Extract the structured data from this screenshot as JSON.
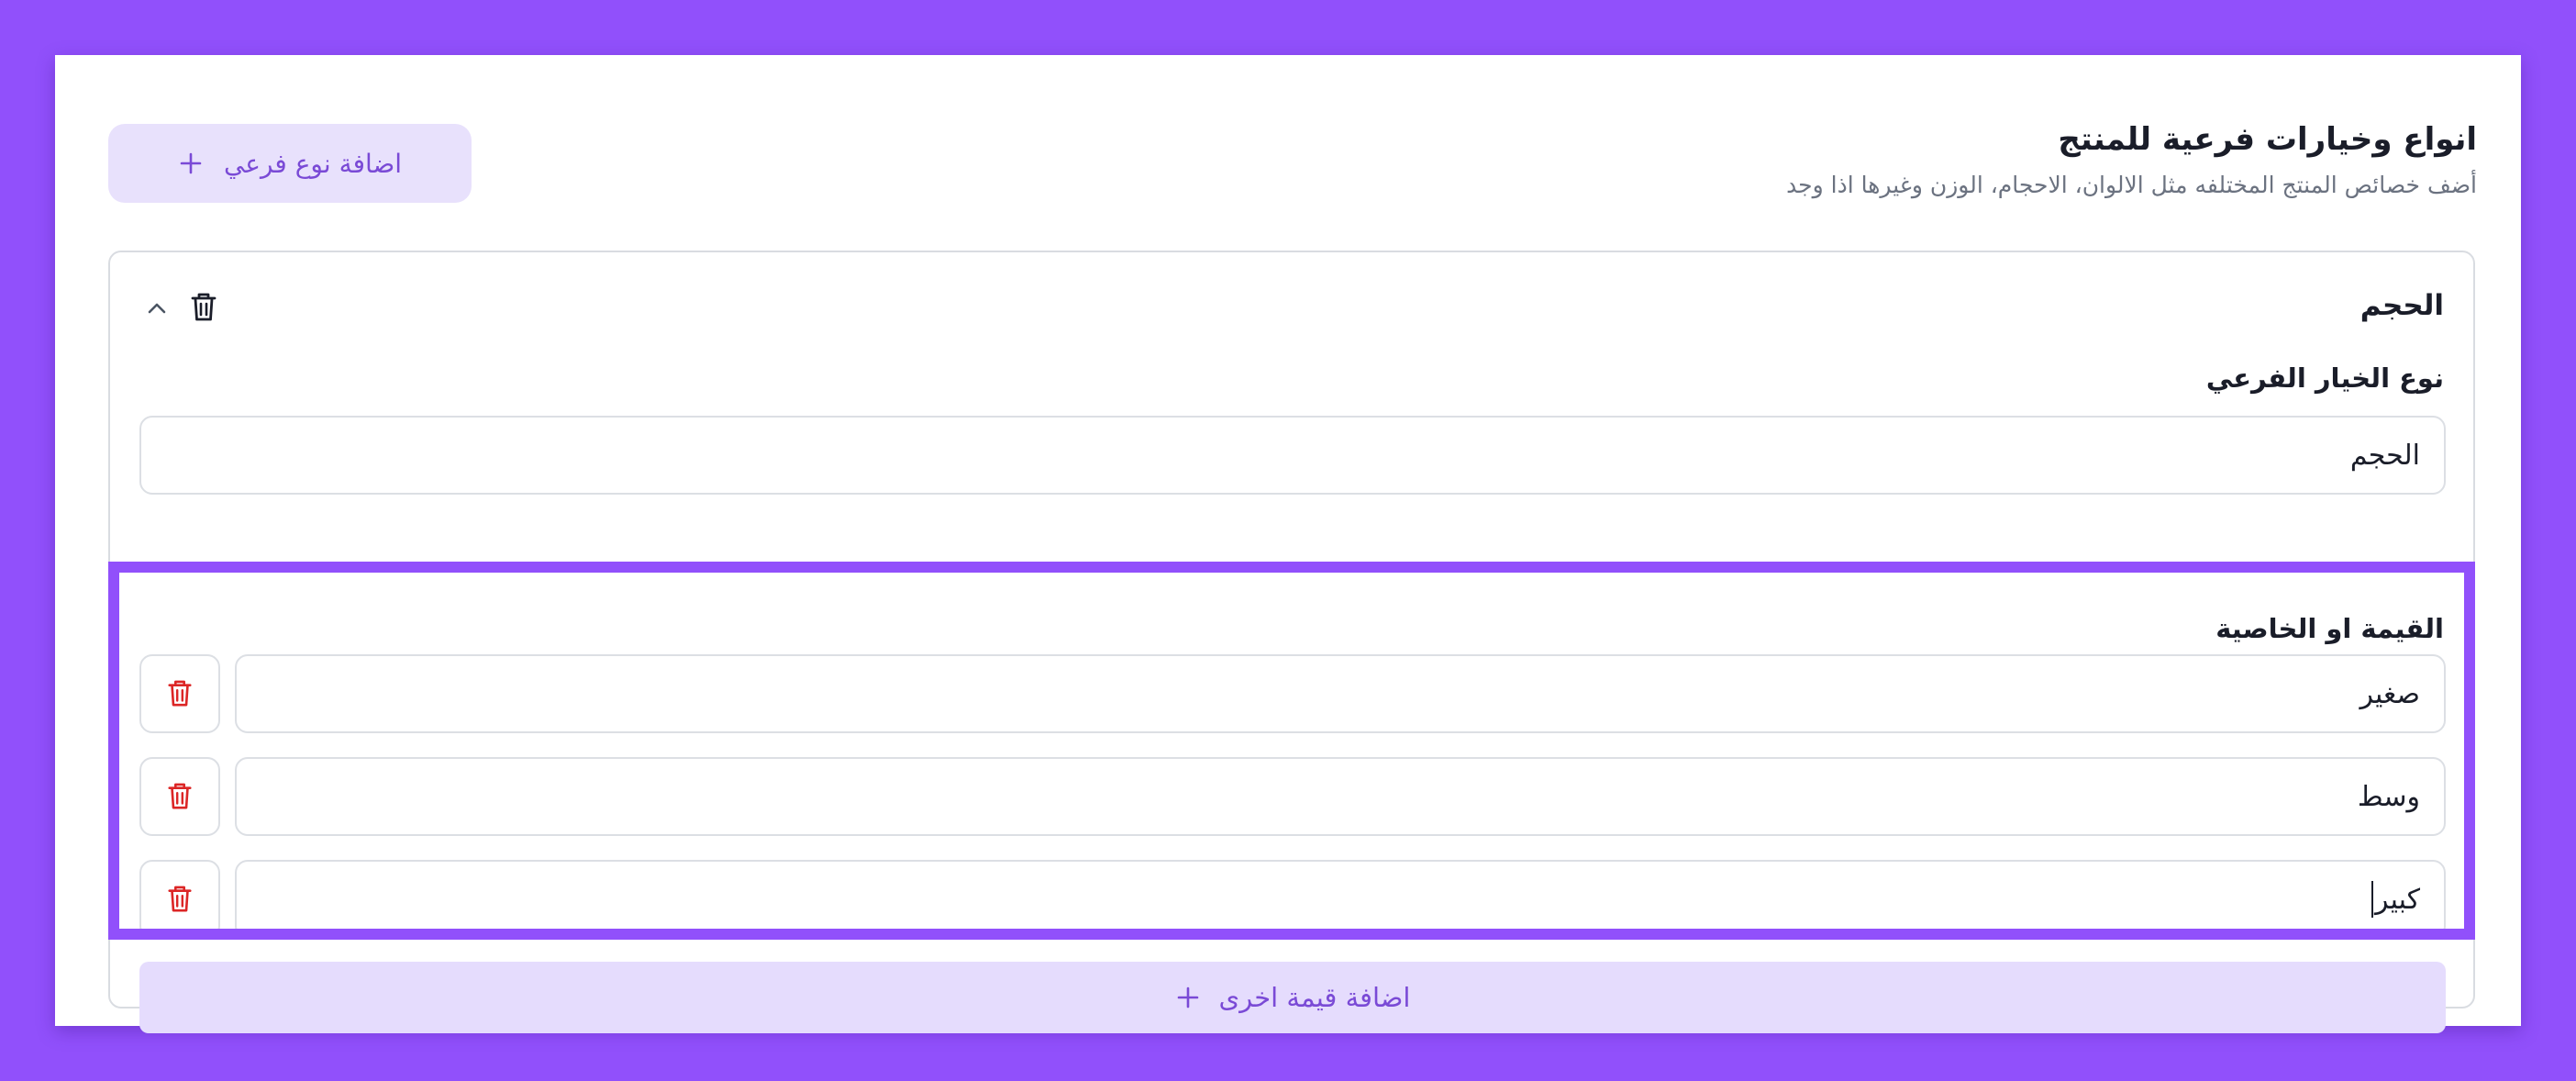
{
  "header": {
    "title": "انواع وخيارات فرعية للمنتج",
    "subtitle": "أضف خصائص المنتج المختلفه مثل الالوان، الاحجام، الوزن وغيرها اذا وجد",
    "add_variant_label": "اضافة نوع فرعي",
    "add_variant_icon": "plus-icon"
  },
  "variant": {
    "title": "الحجم",
    "collapse_icon": "chevron-up-icon",
    "delete_icon": "trash-icon",
    "type_label": "نوع الخيار الفرعي",
    "type_value": "الحجم",
    "values_label": "القيمة او الخاصية",
    "values": [
      {
        "value": "صغير",
        "delete_icon": "trash-icon"
      },
      {
        "value": "وسط",
        "delete_icon": "trash-icon"
      },
      {
        "value": "كبير",
        "delete_icon": "trash-icon"
      }
    ],
    "add_value_label": "اضافة قيمة اخرى",
    "add_value_icon": "plus-icon"
  },
  "colors": {
    "accent": "#9150fb",
    "accent_text": "#7a4ad6",
    "accent_soft": "#e8e1fc",
    "danger": "#dc2626",
    "text": "#1a1d29",
    "muted": "#6b7280",
    "border": "#dcdfe4"
  }
}
